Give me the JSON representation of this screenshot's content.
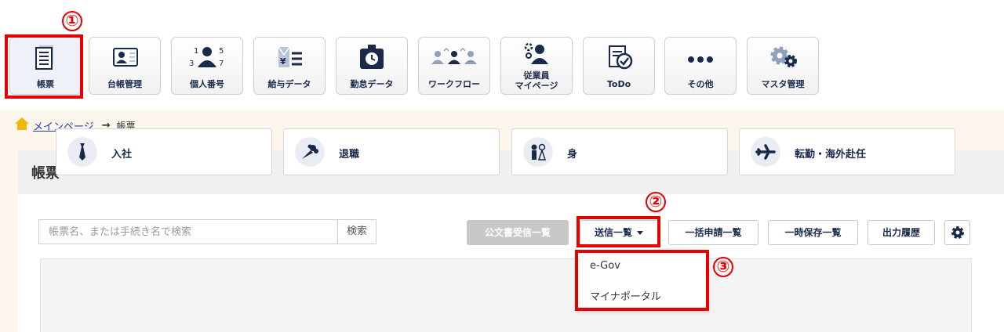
{
  "annotations": {
    "step1": "①",
    "step2": "②",
    "step3": "③"
  },
  "toolbar": {
    "items": [
      {
        "label": "帳票",
        "icon": "document-list-icon",
        "active": true
      },
      {
        "label": "台帳管理",
        "icon": "id-card-icon"
      },
      {
        "label": "個人番号",
        "icon": "person-number-icon",
        "digits": [
          "1",
          "3",
          "5",
          "7"
        ]
      },
      {
        "label": "給与データ",
        "icon": "salary-data-icon",
        "currency": "¥"
      },
      {
        "label": "勤怠データ",
        "icon": "timecard-icon"
      },
      {
        "label": "ワークフロー",
        "icon": "workflow-people-icon"
      },
      {
        "label": "従業員\nマイページ",
        "icon": "employee-mypage-icon"
      },
      {
        "label": "ToDo",
        "icon": "todo-check-icon"
      },
      {
        "label": "その他",
        "icon": "more-dots-icon"
      },
      {
        "label": "マスタ管理",
        "icon": "gears-icon"
      }
    ]
  },
  "breadcrumb": {
    "home_link": "メインページ",
    "separator": "→",
    "current": "帳票"
  },
  "panel": {
    "title": "帳票"
  },
  "search": {
    "placeholder": "帳票名、または手続き名で検索",
    "value": "",
    "button": "検索"
  },
  "actions": {
    "official_received": "公文書受信一覧",
    "sent_list": "送信一覧",
    "bulk_applications": "一括申請一覧",
    "temp_saved": "一時保存一覧",
    "output_history": "出力履歴",
    "settings_icon": "gear-icon"
  },
  "send_dropdown": {
    "items": [
      "e-Gov",
      "マイナポータル"
    ]
  },
  "categories": [
    {
      "label": "入社",
      "icon": "necktie-icon"
    },
    {
      "label": "退職",
      "icon": "bouquet-icon"
    },
    {
      "label": "身",
      "icon": "couple-icon"
    },
    {
      "label": "転勤・海外赴任",
      "icon": "airplane-icon"
    }
  ],
  "colors": {
    "highlight": "#e60000",
    "navy": "#1a2a4a",
    "link": "#1f3f9a",
    "background_cream": "#fdf6ec"
  }
}
